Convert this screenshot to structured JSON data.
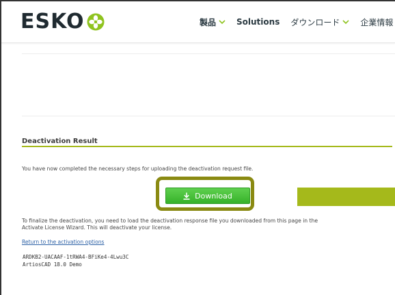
{
  "header": {
    "logo_text": "ESKO",
    "nav": [
      {
        "label": "製品",
        "has_chevron": true
      },
      {
        "label": "Solutions",
        "has_chevron": false
      },
      {
        "label": "ダウンロード",
        "has_chevron": true
      },
      {
        "label": "企業情報",
        "has_chevron": false
      }
    ]
  },
  "section": {
    "title": "Deactivation Result",
    "intro": "You have now completed the necessary steps for uploading the deactivation request file.",
    "download_label": "Download",
    "finalize_line1": "To finalize the deactivation, you need to load the deactivation response file you downloaded from this page in the",
    "finalize_line2": "Activate License Wizard. This will deactivate your license.",
    "return_link": "Return to the activation options",
    "license_code": "ARDKB2-UACAAF-1tRWA4-BFiKe4-4Lwu3C",
    "product": "ArtiosCAD 18.0 Demo"
  },
  "colors": {
    "accent": "#a5b91b",
    "button": "#3fbc33",
    "highlight_border": "#8a8a12",
    "logo_mark": "#8fc31f"
  },
  "icons": {
    "logo_mark": "esko-flower-icon",
    "download": "download-icon",
    "chevron": "chevron-down-icon"
  }
}
